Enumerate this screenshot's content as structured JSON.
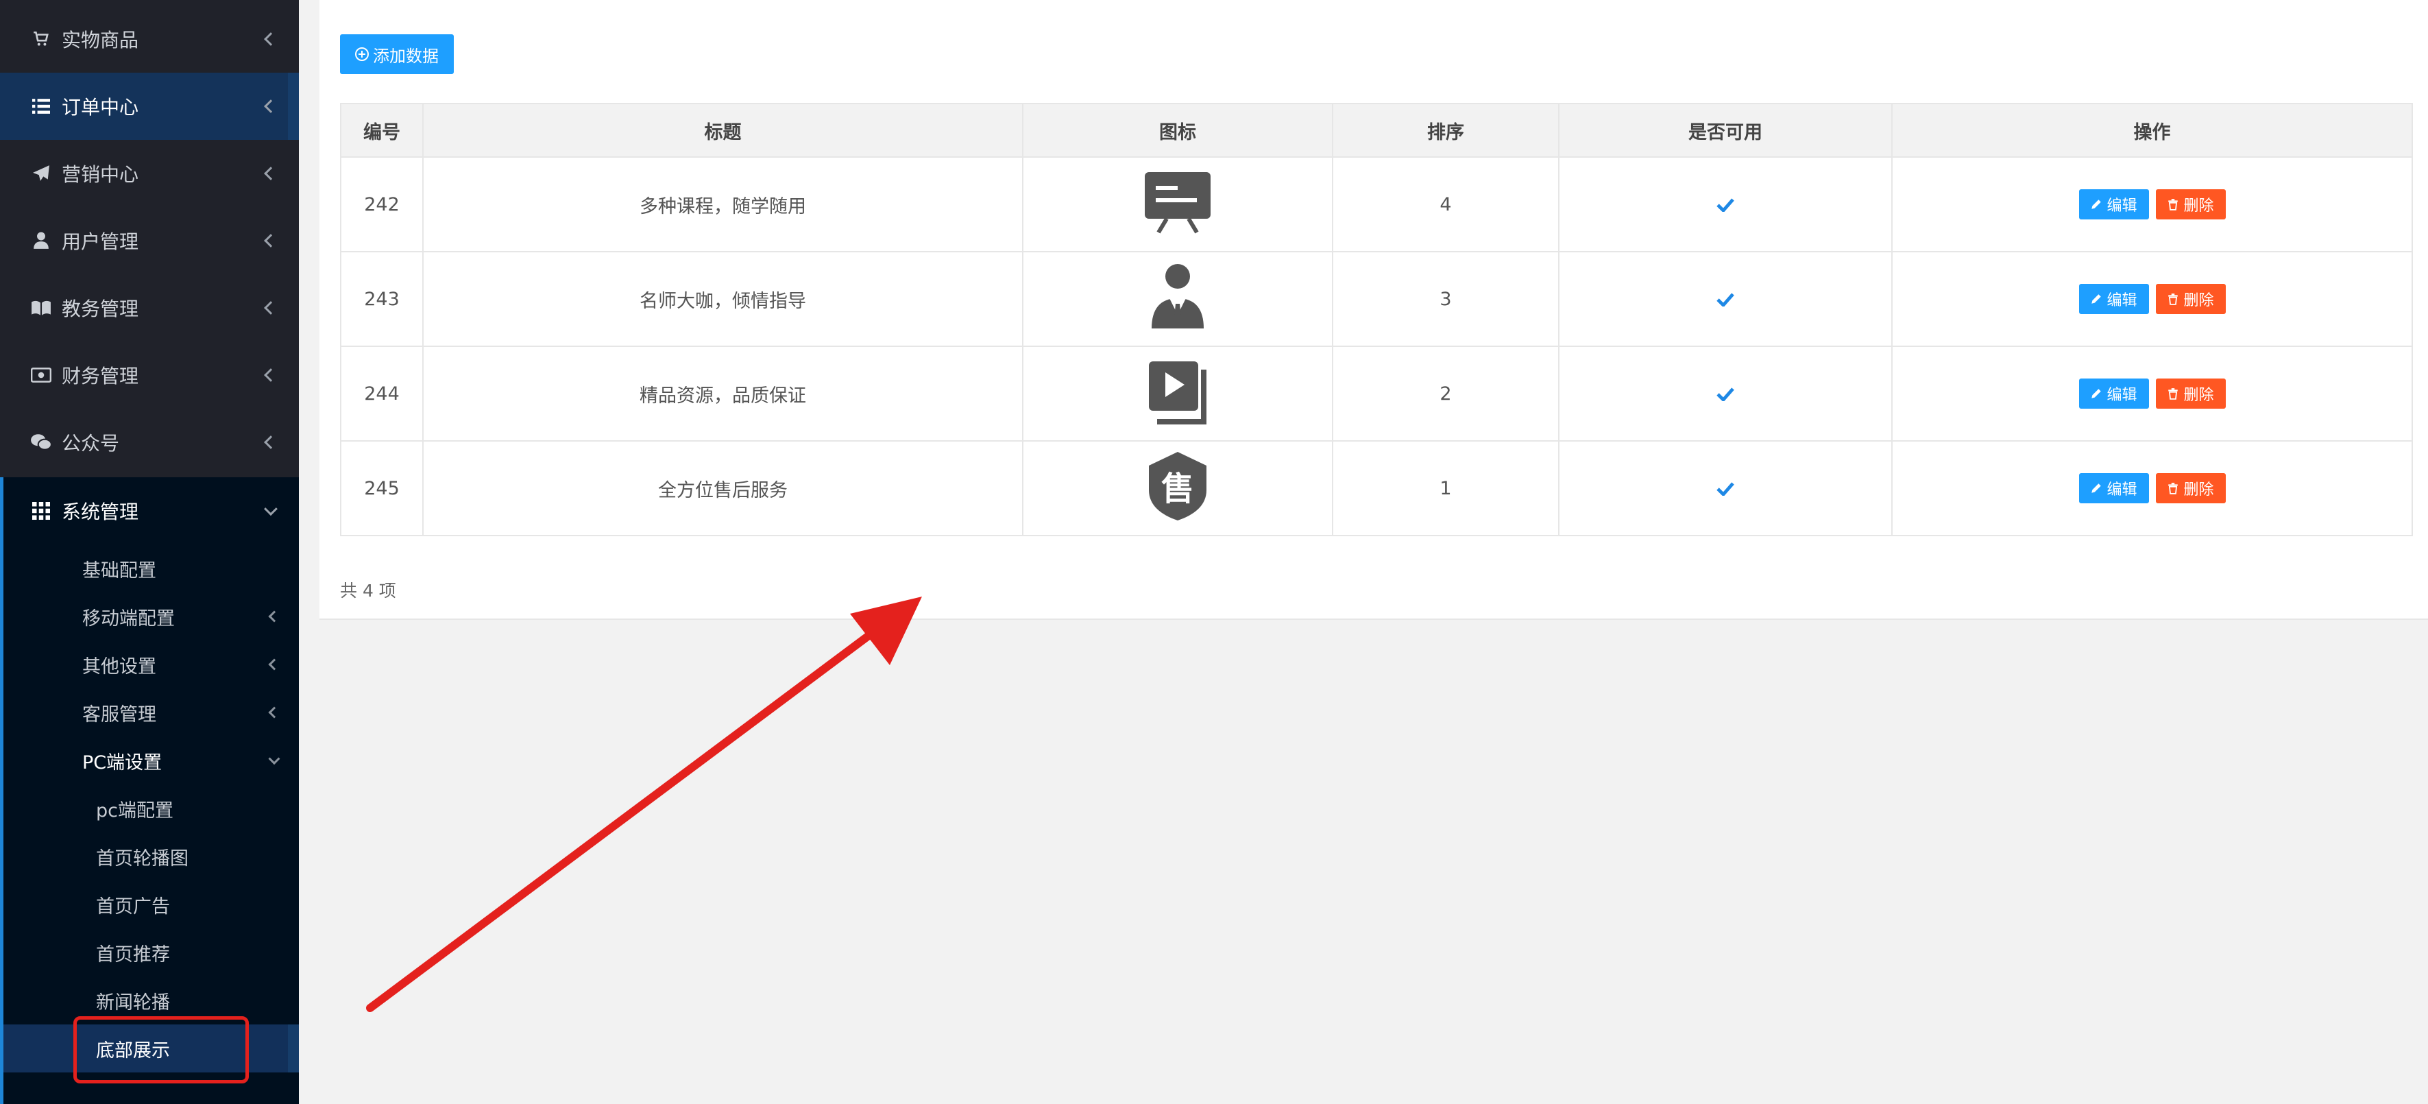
{
  "sidebar": {
    "menu": [
      {
        "label": "实物商品",
        "icon": "cart-icon"
      },
      {
        "label": "订单中心",
        "icon": "list-icon"
      },
      {
        "label": "营销中心",
        "icon": "paper-plane-icon"
      },
      {
        "label": "用户管理",
        "icon": "user-icon"
      },
      {
        "label": "教务管理",
        "icon": "book-icon"
      },
      {
        "label": "财务管理",
        "icon": "money-icon"
      },
      {
        "label": "公众号",
        "icon": "wechat-icon"
      },
      {
        "label": "系统管理",
        "icon": "grid-icon"
      }
    ],
    "submenu": [
      {
        "label": "基础配置"
      },
      {
        "label": "移动端配置"
      },
      {
        "label": "其他设置"
      },
      {
        "label": "客服管理"
      },
      {
        "label": "PC端设置"
      },
      {
        "label": "pc端配置"
      },
      {
        "label": "首页轮播图"
      },
      {
        "label": "首页广告"
      },
      {
        "label": "首页推荐"
      },
      {
        "label": "新闻轮播"
      },
      {
        "label": "底部展示"
      }
    ]
  },
  "toolbar": {
    "add_label": "添加数据"
  },
  "table": {
    "headers": [
      "编号",
      "标题",
      "图标",
      "排序",
      "是否可用",
      "操作"
    ],
    "rows": [
      {
        "id": "242",
        "title": "多种课程，随学随用",
        "icon": "presentation-board-icon",
        "sort": "4"
      },
      {
        "id": "243",
        "title": "名师大咖，倾情指导",
        "icon": "teacher-suit-icon",
        "sort": "3"
      },
      {
        "id": "244",
        "title": "精品资源，品质保证",
        "icon": "video-book-icon",
        "sort": "2"
      },
      {
        "id": "245",
        "title": "全方位售后服务",
        "icon": "after-sales-shield-icon",
        "sort": "1",
        "icon_text": "售"
      }
    ],
    "edit_label": "编辑",
    "delete_label": "删除"
  },
  "footer": {
    "count_text": "共 4 项"
  },
  "colors": {
    "sidebar_bg": "#20222a",
    "submenu_bg": "#000f1e",
    "accent": "#1e9fff",
    "danger": "#ff5722",
    "annotation": "#e4211d"
  }
}
